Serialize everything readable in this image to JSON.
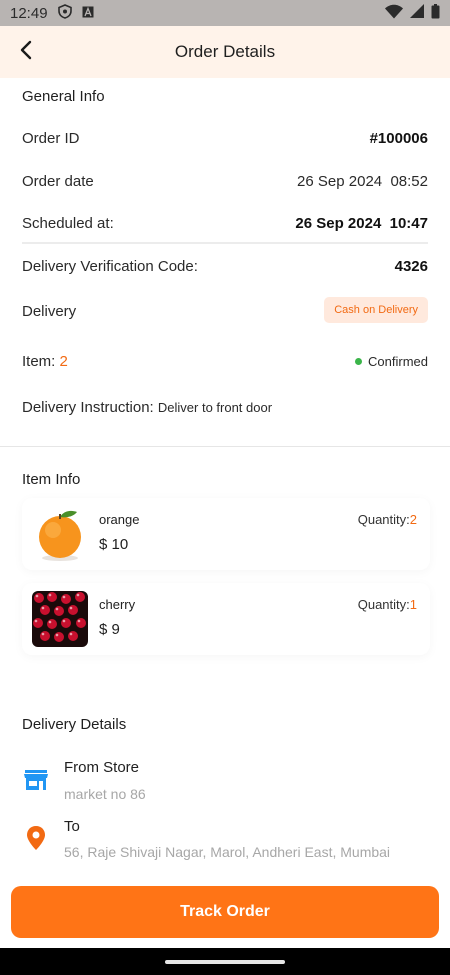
{
  "status_bar": {
    "time": "12:49"
  },
  "header": {
    "title": "Order Details"
  },
  "general_info": {
    "title": "General Info",
    "order_id_label": "Order ID",
    "order_id_value": "#100006",
    "order_date_label": "Order date",
    "order_date_value": "26 Sep 2024  08:52",
    "scheduled_label": "Scheduled at:",
    "scheduled_value": "26 Sep 2024  10:47",
    "verification_label": "Delivery Verification Code:",
    "verification_value": "4326",
    "delivery_label": "Delivery",
    "delivery_badge": "Cash on Delivery",
    "item_label": "Item:",
    "item_count": "2",
    "status": "Confirmed",
    "instruction_label": "Delivery Instruction:",
    "instruction_value": "Deliver to front door"
  },
  "item_info": {
    "title": "Item Info",
    "items": [
      {
        "name": "orange",
        "price": "$ 10",
        "quantity_label": "Quantity:",
        "quantity": "2"
      },
      {
        "name": "cherry",
        "price": "$ 9",
        "quantity_label": "Quantity:",
        "quantity": "1"
      }
    ]
  },
  "delivery_details": {
    "title": "Delivery Details",
    "from_label": "From Store",
    "from_value": "market no 86",
    "to_label": "To",
    "to_value": "56, Raje Shivaji Nagar, Marol, Andheri East, Mumbai"
  },
  "track_button": {
    "label": "Track Order"
  },
  "colors": {
    "accent": "#ff7416",
    "header_bg": "#fff3ea",
    "badge_bg": "#ffe9dd",
    "status_green": "#3bb54a",
    "store_blue": "#2196f3"
  }
}
